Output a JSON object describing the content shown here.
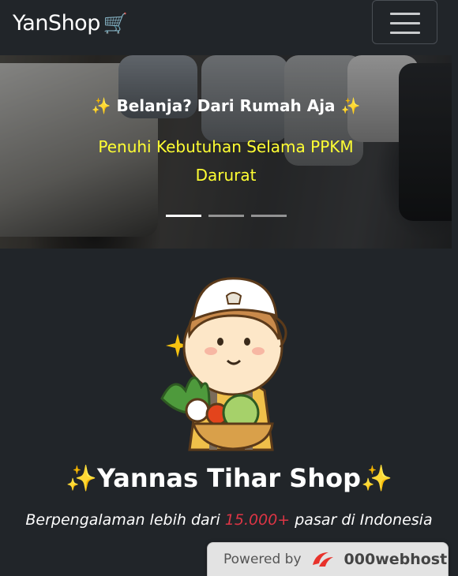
{
  "navbar": {
    "brand": "YanShop",
    "cart_icon": "🛒",
    "toggler_icon": "hamburger-menu-icon"
  },
  "carousel": {
    "caption_title": "✨ Belanja? Dari Rumah Aja ✨",
    "caption_text": "Penuhi Kebutuhan Selama PPKM Darurat",
    "slides": 3,
    "active_slide": 1
  },
  "hero": {
    "image_icon": "farmer-with-vegetables-illustration",
    "title": "✨Yannas Tihar Shop✨",
    "tagline_before": "Berpengalaman lebih dari ",
    "tagline_number": "15.000+",
    "tagline_after": " pasar di Indonesia"
  },
  "footer_badge": {
    "powered_by": "Powered by",
    "host": "000webhost"
  },
  "colors": {
    "background": "#212529",
    "caption_yellow": "#ffff33",
    "accent_red": "#dc3545"
  }
}
